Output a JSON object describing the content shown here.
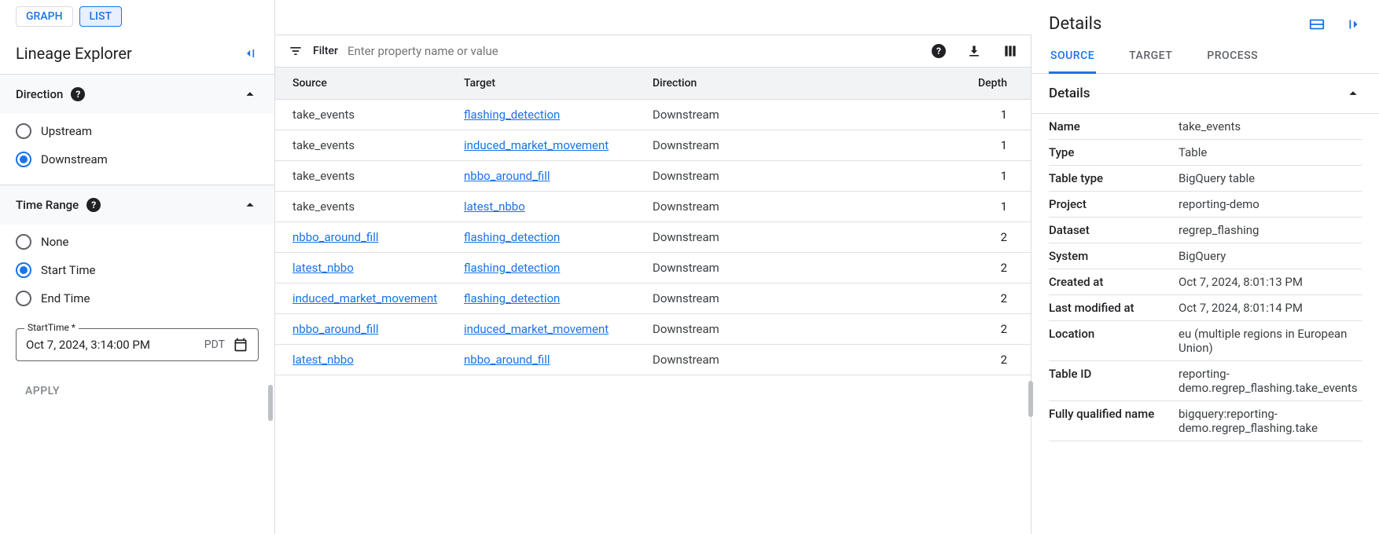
{
  "viewTabs": {
    "graph": "GRAPH",
    "list": "LIST"
  },
  "sidebar": {
    "title": "Lineage Explorer",
    "direction": {
      "label": "Direction",
      "upstream": "Upstream",
      "downstream": "Downstream"
    },
    "timeRange": {
      "label": "Time Range",
      "none": "None",
      "startTime": "Start Time",
      "endTime": "End Time"
    },
    "startTimeField": {
      "label": "StartTime *",
      "value": "Oct 7, 2024, 3:14:00 PM",
      "tz": "PDT"
    },
    "apply": "APPLY"
  },
  "filter": {
    "label": "Filter",
    "placeholder": "Enter property name or value"
  },
  "columns": {
    "source": "Source",
    "target": "Target",
    "direction": "Direction",
    "depth": "Depth"
  },
  "rows": [
    {
      "s": "take_events",
      "sl": false,
      "t": "flashing_detection",
      "d": "Downstream",
      "n": "1"
    },
    {
      "s": "take_events",
      "sl": false,
      "t": "induced_market_movement",
      "d": "Downstream",
      "n": "1"
    },
    {
      "s": "take_events",
      "sl": false,
      "t": "nbbo_around_fill",
      "d": "Downstream",
      "n": "1"
    },
    {
      "s": "take_events",
      "sl": false,
      "t": "latest_nbbo",
      "d": "Downstream",
      "n": "1"
    },
    {
      "s": "nbbo_around_fill",
      "sl": true,
      "t": "flashing_detection",
      "d": "Downstream",
      "n": "2"
    },
    {
      "s": "latest_nbbo",
      "sl": true,
      "t": "flashing_detection",
      "d": "Downstream",
      "n": "2"
    },
    {
      "s": "induced_market_movement",
      "sl": true,
      "t": "flashing_detection",
      "d": "Downstream",
      "n": "2"
    },
    {
      "s": "nbbo_around_fill",
      "sl": true,
      "t": "induced_market_movement",
      "d": "Downstream",
      "n": "2"
    },
    {
      "s": "latest_nbbo",
      "sl": true,
      "t": "nbbo_around_fill",
      "d": "Downstream",
      "n": "2"
    }
  ],
  "details": {
    "title": "Details",
    "tabs": {
      "source": "SOURCE",
      "target": "TARGET",
      "process": "PROCESS"
    },
    "section": "Details",
    "props": [
      {
        "k": "Name",
        "v": "take_events"
      },
      {
        "k": "Type",
        "v": "Table"
      },
      {
        "k": "Table type",
        "v": "BigQuery table"
      },
      {
        "k": "Project",
        "v": "reporting-demo"
      },
      {
        "k": "Dataset",
        "v": "regrep_flashing"
      },
      {
        "k": "System",
        "v": "BigQuery"
      },
      {
        "k": "Created at",
        "v": "Oct 7, 2024, 8:01:13 PM"
      },
      {
        "k": "Last modified at",
        "v": "Oct 7, 2024, 8:01:14 PM"
      },
      {
        "k": "Location",
        "v": "eu (multiple regions in European Union)"
      },
      {
        "k": "Table ID",
        "v": "reporting-demo.regrep_flashing.take_events"
      },
      {
        "k": "Fully qualified name",
        "v": "bigquery:reporting-demo.regrep_flashing.take"
      }
    ]
  }
}
